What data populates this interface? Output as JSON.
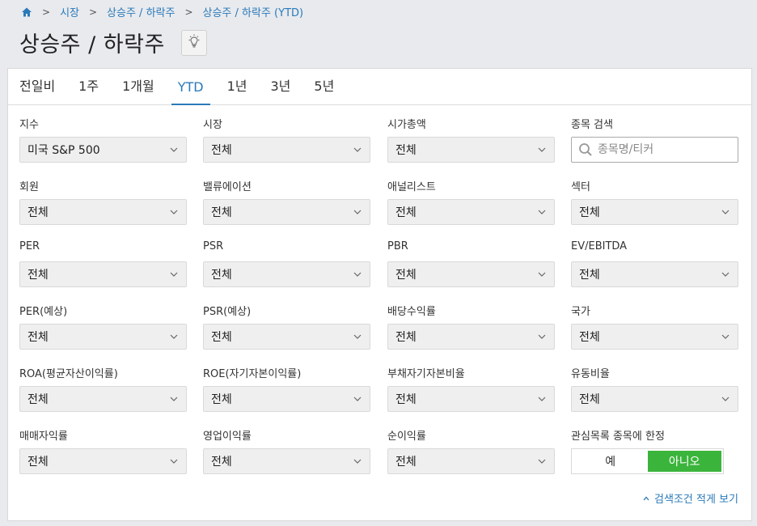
{
  "breadcrumb": {
    "items": [
      "시장",
      "상승주 / 하락주",
      "상승주 / 하락주 (YTD)"
    ]
  },
  "page": {
    "title": "상승주 / 하락주"
  },
  "tabs": [
    {
      "label": "전일비",
      "active": false
    },
    {
      "label": "1주",
      "active": false
    },
    {
      "label": "1개월",
      "active": false
    },
    {
      "label": "YTD",
      "active": true
    },
    {
      "label": "1년",
      "active": false
    },
    {
      "label": "3년",
      "active": false
    },
    {
      "label": "5년",
      "active": false
    }
  ],
  "filters": {
    "index": {
      "label": "지수",
      "value": "미국 S&P 500"
    },
    "market": {
      "label": "시장",
      "value": "전체"
    },
    "market_cap": {
      "label": "시가총액",
      "value": "전체"
    },
    "search": {
      "label": "종목 검색",
      "placeholder": "종목명/티커"
    },
    "member": {
      "label": "회원",
      "value": "전체"
    },
    "valuation": {
      "label": "밸류에이션",
      "value": "전체"
    },
    "analyst": {
      "label": "애널리스트",
      "value": "전체"
    },
    "sector": {
      "label": "섹터",
      "value": "전체"
    },
    "per": {
      "label": "PER",
      "value": "전체"
    },
    "psr": {
      "label": "PSR",
      "value": "전체"
    },
    "pbr": {
      "label": "PBR",
      "value": "전체"
    },
    "ev_ebitda": {
      "label": "EV/EBITDA",
      "value": "전체"
    },
    "per_forecast": {
      "label": "PER(예상)",
      "value": "전체"
    },
    "psr_forecast": {
      "label": "PSR(예상)",
      "value": "전체"
    },
    "dividend_yield": {
      "label": "배당수익률",
      "value": "전체"
    },
    "country": {
      "label": "국가",
      "value": "전체"
    },
    "roa": {
      "label": "ROA(평균자산이익률)",
      "value": "전체"
    },
    "roe": {
      "label": "ROE(자기자본이익률)",
      "value": "전체"
    },
    "debt_ratio": {
      "label": "부채자기자본비율",
      "value": "전체"
    },
    "current_ratio": {
      "label": "유동비율",
      "value": "전체"
    },
    "gross_margin": {
      "label": "매매자익률",
      "value": "전체"
    },
    "operating_margin": {
      "label": "영업이익률",
      "value": "전체"
    },
    "net_margin": {
      "label": "순이익률",
      "value": "전체"
    },
    "watchlist_only": {
      "label": "관심목록 종목에 한정",
      "yes": "예",
      "no": "아니오",
      "selected": "no"
    }
  },
  "footer": {
    "collapse_label": "검색조건 적게 보기"
  },
  "colors": {
    "accent": "#2a7ab9",
    "toggle_on": "#3bb43c"
  }
}
